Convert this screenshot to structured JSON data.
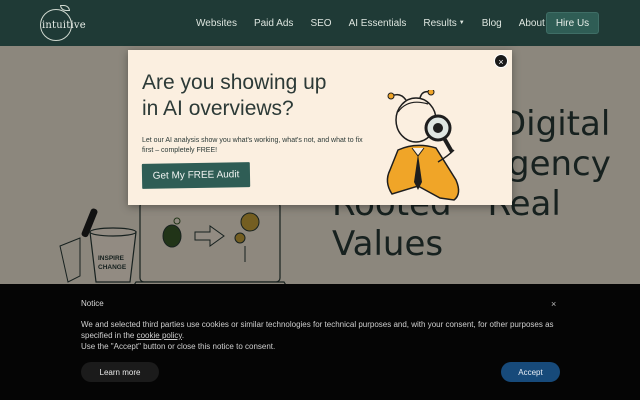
{
  "nav": {
    "logo_text": "intuitive",
    "links": [
      "Websites",
      "Paid Ads",
      "SEO",
      "AI Essentials",
      "Results",
      "Blog",
      "About"
    ],
    "results_has_menu": true,
    "about_has_menu": true,
    "hire_label": "Hire Us"
  },
  "hero": {
    "title_lines": [
      "Digital",
      "gency",
      "Rooted",
      "Real",
      "Values"
    ],
    "illus_cup_text_1": "INSPIRE",
    "illus_cup_text_2": "CHANGE"
  },
  "popup": {
    "title_line1": "Are you showing up",
    "title_line2": "in AI overviews?",
    "body": "Let our AI analysis show you what's working, what's not, and what to fix first – completely FREE!",
    "button": "Get My FREE Audit",
    "close": "×"
  },
  "cookie": {
    "title": "Notice",
    "close": "×",
    "text_before_link": "We and selected third parties use cookies or similar technologies for technical purposes and, with your consent, for other purposes as specified in the ",
    "link": "cookie policy",
    "text_after_link": ".",
    "text_line2": "Use the \"Accept\" button or close this notice to consent.",
    "learn_more": "Learn more",
    "accept": "Accept"
  },
  "colors": {
    "nav_bg": "#1f3a36",
    "brand_green": "#2f5d55",
    "page_bg": "#f2e8d8",
    "popup_bg": "#fbefe0",
    "accept_blue": "#174a7a",
    "figure_orange": "#f0a528"
  }
}
